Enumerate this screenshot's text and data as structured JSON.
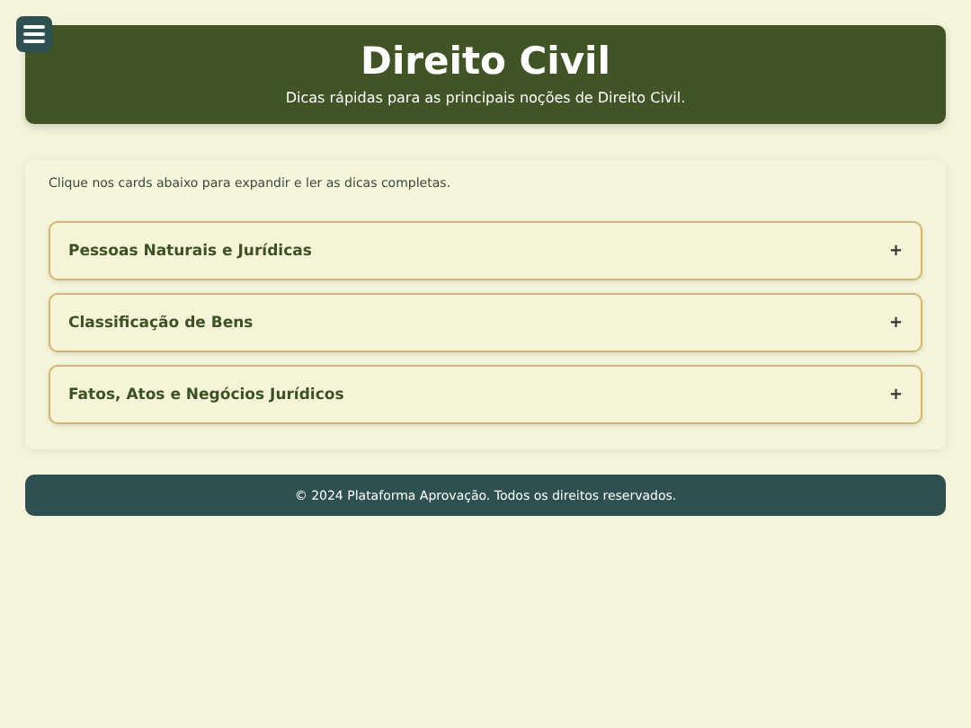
{
  "header": {
    "title": "Direito Civil",
    "subtitle": "Dicas rápidas para as principais noções de Direito Civil."
  },
  "intro": "Clique nos cards abaixo para expandir e ler as dicas completas.",
  "cards": [
    {
      "title": "Pessoas Naturais e Jurídicas",
      "toggle": "+"
    },
    {
      "title": "Classificação de Bens",
      "toggle": "+"
    },
    {
      "title": "Fatos, Atos e Negócios Jurídicos",
      "toggle": "+"
    }
  ],
  "footer": "© 2024 Plataforma Aprovação. Todos os direitos reservados."
}
